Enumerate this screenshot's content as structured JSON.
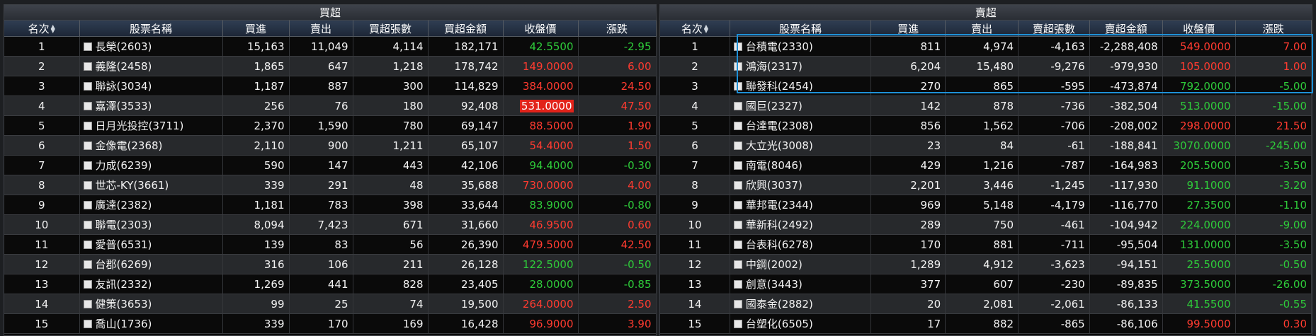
{
  "buy": {
    "title": "買超",
    "columns": [
      "名次",
      "股票名稱",
      "買進",
      "賣出",
      "買超張數",
      "買超金額",
      "收盤價",
      "漲跌"
    ],
    "rows": [
      {
        "rank": "1",
        "name": "長榮(2603)",
        "buy": "15,163",
        "sell": "11,049",
        "net": "4,114",
        "amount": "182,171",
        "close": "42.5500",
        "change": "-2.95",
        "dir": "down"
      },
      {
        "rank": "2",
        "name": "義隆(2458)",
        "buy": "1,865",
        "sell": "647",
        "net": "1,218",
        "amount": "178,742",
        "close": "149.0000",
        "change": "6.00",
        "dir": "up"
      },
      {
        "rank": "3",
        "name": "聯詠(3034)",
        "buy": "1,187",
        "sell": "887",
        "net": "300",
        "amount": "114,829",
        "close": "384.0000",
        "change": "24.50",
        "dir": "up"
      },
      {
        "rank": "4",
        "name": "嘉澤(3533)",
        "buy": "256",
        "sell": "76",
        "net": "180",
        "amount": "92,408",
        "close": "531.0000",
        "change": "47.50",
        "dir": "up",
        "hl": true
      },
      {
        "rank": "5",
        "name": "日月光投控(3711)",
        "buy": "2,370",
        "sell": "1,590",
        "net": "780",
        "amount": "69,147",
        "close": "88.5000",
        "change": "1.90",
        "dir": "up"
      },
      {
        "rank": "6",
        "name": "金像電(2368)",
        "buy": "2,110",
        "sell": "900",
        "net": "1,211",
        "amount": "65,107",
        "close": "54.4000",
        "change": "1.50",
        "dir": "up"
      },
      {
        "rank": "7",
        "name": "力成(6239)",
        "buy": "590",
        "sell": "147",
        "net": "443",
        "amount": "42,106",
        "close": "94.4000",
        "change": "-0.30",
        "dir": "down"
      },
      {
        "rank": "8",
        "name": "世芯-KY(3661)",
        "buy": "339",
        "sell": "291",
        "net": "48",
        "amount": "35,688",
        "close": "730.0000",
        "change": "4.00",
        "dir": "up"
      },
      {
        "rank": "9",
        "name": "廣達(2382)",
        "buy": "1,181",
        "sell": "783",
        "net": "398",
        "amount": "33,644",
        "close": "83.9000",
        "change": "-0.80",
        "dir": "down"
      },
      {
        "rank": "10",
        "name": "聯電(2303)",
        "buy": "8,094",
        "sell": "7,423",
        "net": "671",
        "amount": "31,660",
        "close": "46.9500",
        "change": "0.60",
        "dir": "up"
      },
      {
        "rank": "11",
        "name": "愛普(6531)",
        "buy": "139",
        "sell": "83",
        "net": "56",
        "amount": "26,390",
        "close": "479.5000",
        "change": "42.50",
        "dir": "up"
      },
      {
        "rank": "12",
        "name": "台郡(6269)",
        "buy": "316",
        "sell": "106",
        "net": "211",
        "amount": "26,128",
        "close": "122.5000",
        "change": "-0.50",
        "dir": "down"
      },
      {
        "rank": "13",
        "name": "友訊(2332)",
        "buy": "1,269",
        "sell": "441",
        "net": "828",
        "amount": "23,405",
        "close": "28.0000",
        "change": "-0.85",
        "dir": "down"
      },
      {
        "rank": "14",
        "name": "健策(3653)",
        "buy": "99",
        "sell": "25",
        "net": "74",
        "amount": "19,500",
        "close": "264.0000",
        "change": "2.50",
        "dir": "up"
      },
      {
        "rank": "15",
        "name": "喬山(1736)",
        "buy": "339",
        "sell": "170",
        "net": "169",
        "amount": "16,428",
        "close": "96.9000",
        "change": "3.90",
        "dir": "up"
      }
    ]
  },
  "sell": {
    "title": "賣超",
    "columns": [
      "名次",
      "股票名稱",
      "買進",
      "賣出",
      "賣超張數",
      "賣超金額",
      "收盤價",
      "漲跌"
    ],
    "rows": [
      {
        "rank": "1",
        "name": "台積電(2330)",
        "buy": "811",
        "sell": "4,974",
        "net": "-4,163",
        "amount": "-2,288,408",
        "close": "549.0000",
        "change": "7.00",
        "dir": "up"
      },
      {
        "rank": "2",
        "name": "鴻海(2317)",
        "buy": "6,204",
        "sell": "15,480",
        "net": "-9,276",
        "amount": "-979,930",
        "close": "105.0000",
        "change": "1.00",
        "dir": "up"
      },
      {
        "rank": "3",
        "name": "聯發科(2454)",
        "buy": "270",
        "sell": "865",
        "net": "-595",
        "amount": "-473,874",
        "close": "792.0000",
        "change": "-5.00",
        "dir": "down"
      },
      {
        "rank": "4",
        "name": "國巨(2327)",
        "buy": "142",
        "sell": "878",
        "net": "-736",
        "amount": "-382,504",
        "close": "513.0000",
        "change": "-15.00",
        "dir": "down"
      },
      {
        "rank": "5",
        "name": "台達電(2308)",
        "buy": "856",
        "sell": "1,562",
        "net": "-706",
        "amount": "-208,002",
        "close": "298.0000",
        "change": "21.50",
        "dir": "up"
      },
      {
        "rank": "6",
        "name": "大立光(3008)",
        "buy": "23",
        "sell": "84",
        "net": "-61",
        "amount": "-188,841",
        "close": "3070.0000",
        "change": "-245.00",
        "dir": "down"
      },
      {
        "rank": "7",
        "name": "南電(8046)",
        "buy": "429",
        "sell": "1,216",
        "net": "-787",
        "amount": "-164,983",
        "close": "205.5000",
        "change": "-3.50",
        "dir": "down"
      },
      {
        "rank": "8",
        "name": "欣興(3037)",
        "buy": "2,201",
        "sell": "3,446",
        "net": "-1,245",
        "amount": "-117,930",
        "close": "91.1000",
        "change": "-3.20",
        "dir": "down"
      },
      {
        "rank": "9",
        "name": "華邦電(2344)",
        "buy": "969",
        "sell": "5,148",
        "net": "-4,179",
        "amount": "-116,770",
        "close": "27.3500",
        "change": "-1.10",
        "dir": "down"
      },
      {
        "rank": "10",
        "name": "華新科(2492)",
        "buy": "289",
        "sell": "750",
        "net": "-461",
        "amount": "-104,942",
        "close": "224.0000",
        "change": "-9.00",
        "dir": "down"
      },
      {
        "rank": "11",
        "name": "台表科(6278)",
        "buy": "170",
        "sell": "881",
        "net": "-711",
        "amount": "-95,504",
        "close": "131.0000",
        "change": "-3.50",
        "dir": "down"
      },
      {
        "rank": "12",
        "name": "中鋼(2002)",
        "buy": "1,289",
        "sell": "4,912",
        "net": "-3,623",
        "amount": "-94,151",
        "close": "25.5000",
        "change": "-0.50",
        "dir": "down"
      },
      {
        "rank": "13",
        "name": "創意(3443)",
        "buy": "377",
        "sell": "607",
        "net": "-230",
        "amount": "-89,835",
        "close": "373.5000",
        "change": "-26.00",
        "dir": "down"
      },
      {
        "rank": "14",
        "name": "國泰金(2882)",
        "buy": "20",
        "sell": "2,081",
        "net": "-2,061",
        "amount": "-86,133",
        "close": "41.5500",
        "change": "-0.55",
        "dir": "down"
      },
      {
        "rank": "15",
        "name": "台塑化(6505)",
        "buy": "17",
        "sell": "882",
        "net": "-865",
        "amount": "-86,106",
        "close": "99.5000",
        "change": "0.30",
        "dir": "up"
      }
    ]
  },
  "colors": {
    "up": "#ff3b30",
    "down": "#2ecb3a",
    "highlight": "#e2231a",
    "selection": "#1e90d6"
  }
}
